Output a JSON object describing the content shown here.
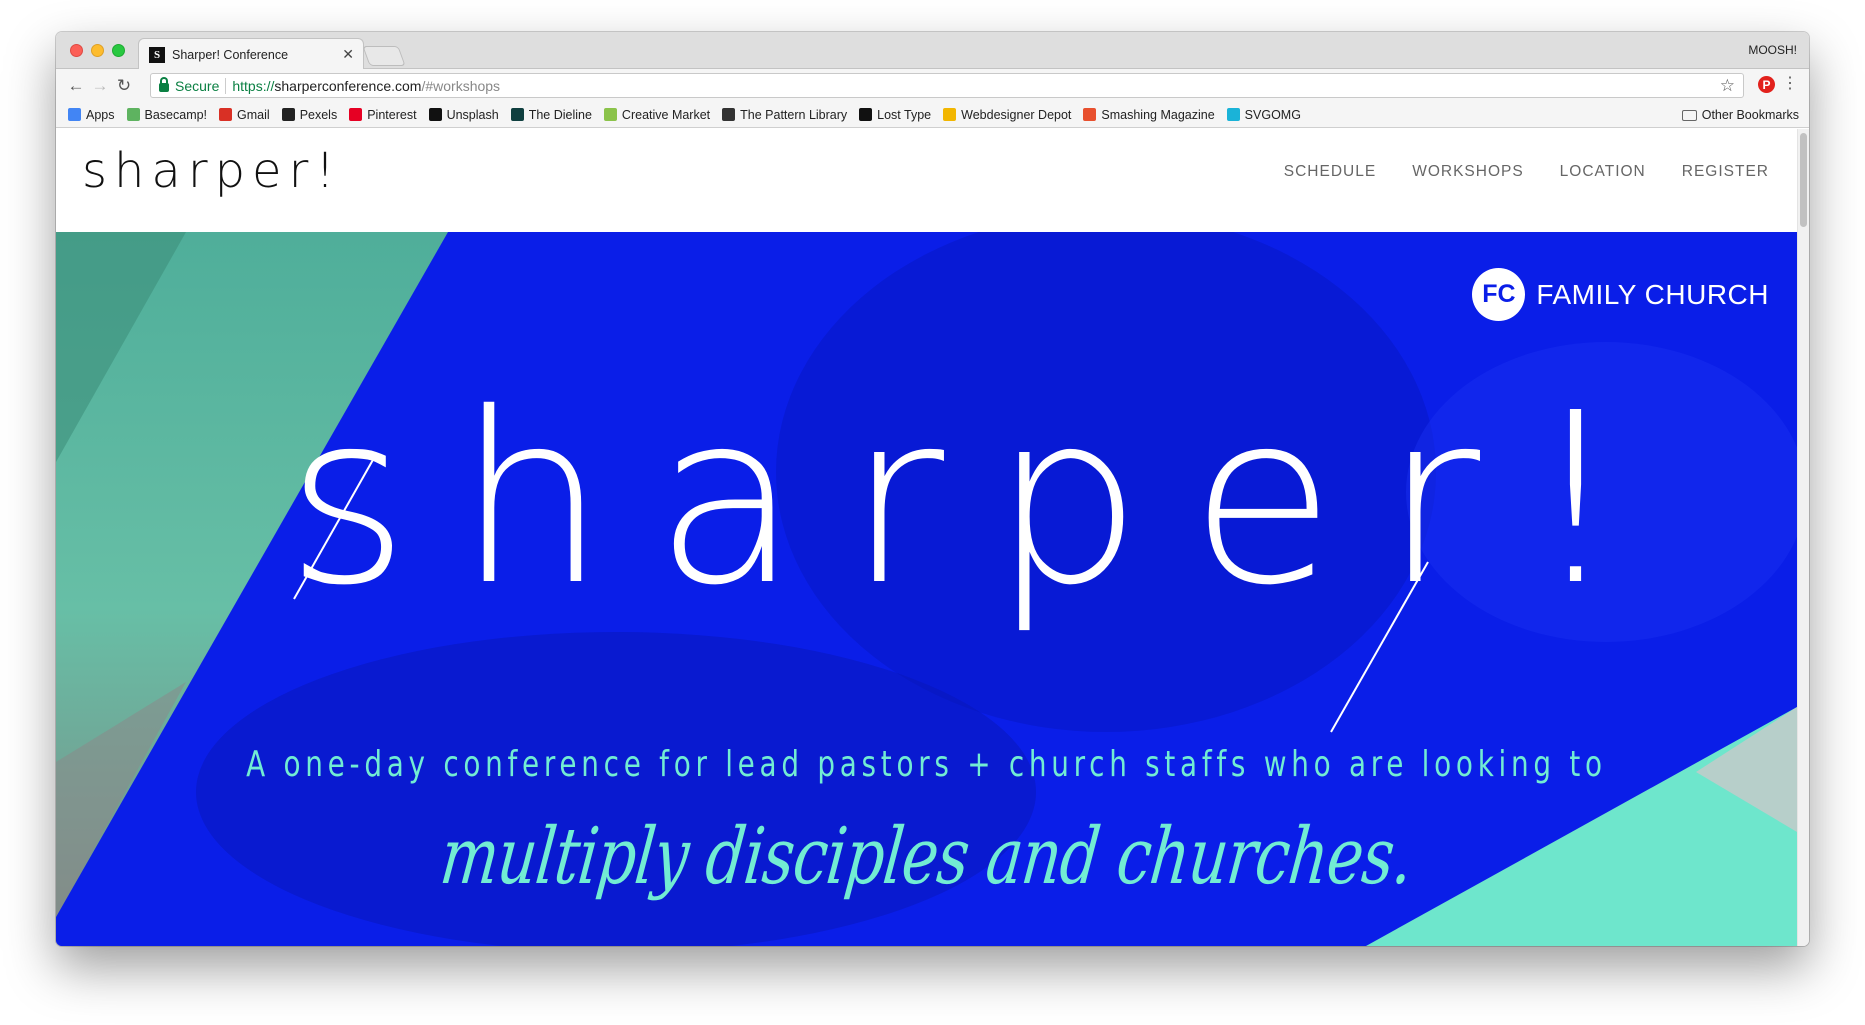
{
  "browser": {
    "tab_title": "Sharper! Conference",
    "tab_favicon": "S",
    "profile_name": "MOOSH!",
    "secure_label": "Secure",
    "url_scheme": "https://",
    "url_host": "sharperconference.com",
    "url_path": "/#workshops",
    "bookmarks": [
      {
        "label": "Apps",
        "icon": "apps-grid-icon",
        "color": "#4285f4"
      },
      {
        "label": "Basecamp!",
        "icon": "basecamp-icon",
        "color": "#5eb360"
      },
      {
        "label": "Gmail",
        "icon": "gmail-icon",
        "color": "#d93025"
      },
      {
        "label": "Pexels",
        "icon": "pexels-icon",
        "color": "#222222"
      },
      {
        "label": "Pinterest",
        "icon": "pinterest-icon",
        "color": "#e60023"
      },
      {
        "label": "Unsplash",
        "icon": "camera-icon",
        "color": "#111111"
      },
      {
        "label": "The Dieline",
        "icon": "dieline-icon",
        "color": "#0f3f3f"
      },
      {
        "label": "Creative Market",
        "icon": "creative-market-icon",
        "color": "#8bc34a"
      },
      {
        "label": "The Pattern Library",
        "icon": "pattern-grid-icon",
        "color": "#333333"
      },
      {
        "label": "Lost Type",
        "icon": "lost-type-icon",
        "color": "#111111"
      },
      {
        "label": "Webdesigner Depot",
        "icon": "webdesigner-depot-icon",
        "color": "#f2b600"
      },
      {
        "label": "Smashing Magazine",
        "icon": "smashing-icon",
        "color": "#e8502e"
      },
      {
        "label": "SVGOMG",
        "icon": "svgomg-icon",
        "color": "#1ab3d8"
      }
    ],
    "other_bookmarks": "Other Bookmarks"
  },
  "site": {
    "logo": "sharper!",
    "nav": [
      "SCHEDULE",
      "WORKSHOPS",
      "LOCATION",
      "REGISTER"
    ],
    "hero": {
      "partner_badge": "FC",
      "partner_name": "FAMILY CHURCH",
      "headline": "sharper!",
      "tagline": "A one-day conference for lead pastors + church staffs who are looking to",
      "script_line": "multiply disciples and churches."
    },
    "colors": {
      "hero_blue": "#0a1ee8",
      "mint": "#72ecd3"
    }
  }
}
